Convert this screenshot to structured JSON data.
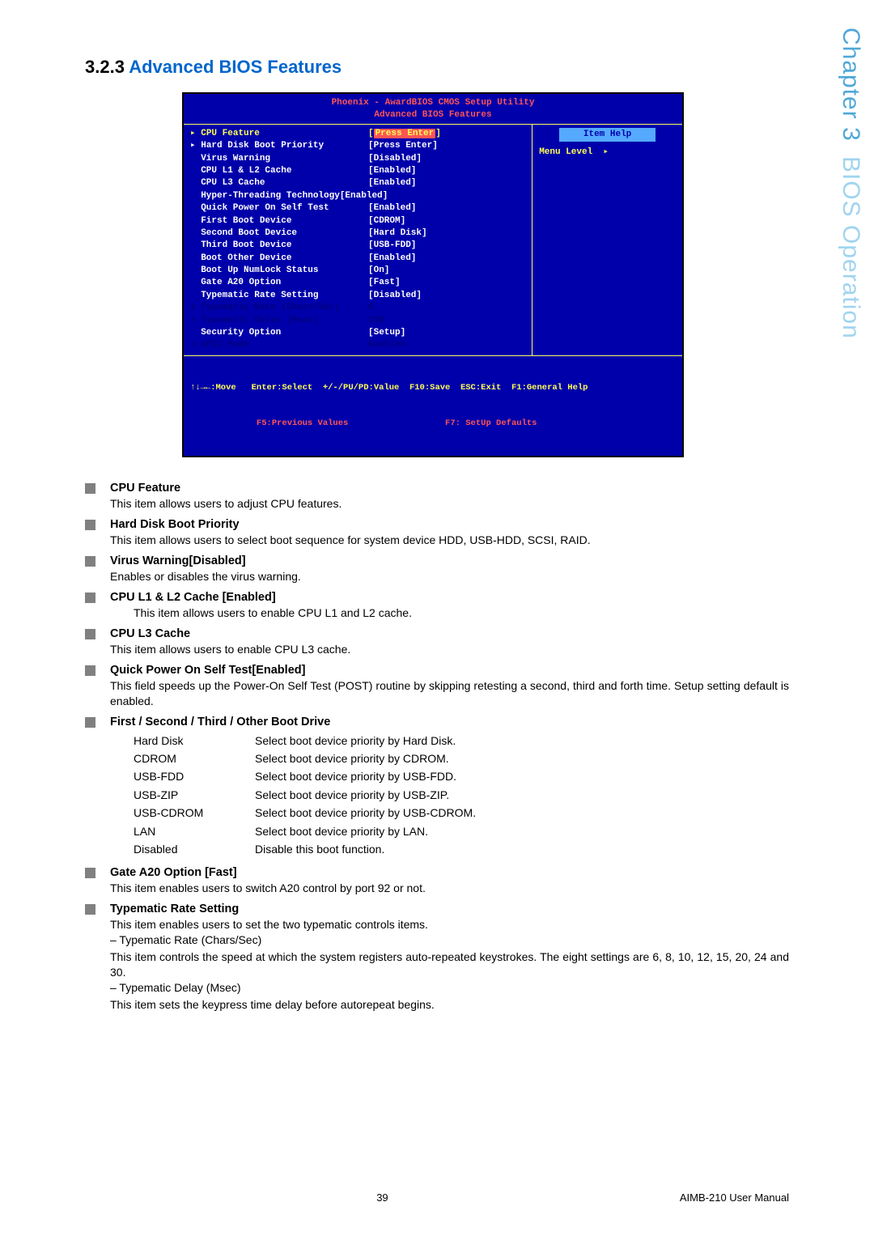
{
  "section": {
    "number": "3.2.3",
    "title": "Advanced BIOS Features"
  },
  "side_tab": {
    "chapter": "Chapter 3",
    "name": "BIOS Operation"
  },
  "bios": {
    "header_l1": "Phoenix - AwardBIOS CMOS Setup Utility",
    "header_l2": "Advanced BIOS Features",
    "right": {
      "item_help": "Item Help",
      "menu_level_label": "Menu Level",
      "menu_level_arrow": "▸"
    },
    "rows": [
      {
        "prefix": "▸",
        "label": "CPU Feature",
        "value": "[",
        "hl": "Press Enter",
        "suffix": "]",
        "row_color": "yellow"
      },
      {
        "prefix": "▸",
        "label": "Hard Disk Boot Priority",
        "value": "[Press Enter]",
        "row_color": "white"
      },
      {
        "prefix": " ",
        "label": "Virus Warning",
        "value": "[Disabled]",
        "row_color": "white"
      },
      {
        "prefix": " ",
        "label": "CPU L1 & L2 Cache",
        "value": "[Enabled]",
        "row_color": "white"
      },
      {
        "prefix": " ",
        "label": "CPU L3 Cache",
        "value": "[Enabled]",
        "row_color": "white"
      },
      {
        "prefix": " ",
        "label": "Hyper-Threading Technology[Enabled]",
        "value": "",
        "row_color": "white"
      },
      {
        "prefix": " ",
        "label": "Quick Power On Self Test",
        "value": "[Enabled]",
        "row_color": "white"
      },
      {
        "prefix": " ",
        "label": "First Boot Device",
        "value": "[CDROM]",
        "row_color": "white"
      },
      {
        "prefix": " ",
        "label": "Second Boot Device",
        "value": "[Hard Disk]",
        "row_color": "white"
      },
      {
        "prefix": " ",
        "label": "Third Boot Device",
        "value": "[USB-FDD]",
        "row_color": "white"
      },
      {
        "prefix": " ",
        "label": "Boot Other Device",
        "value": "[Enabled]",
        "row_color": "white"
      },
      {
        "prefix": " ",
        "label": "Boot Up NumLock Status",
        "value": "[On]",
        "row_color": "white"
      },
      {
        "prefix": " ",
        "label": "Gate A20 Option",
        "value": "[Fast]",
        "row_color": "white"
      },
      {
        "prefix": " ",
        "label": "Typematic Rate Setting",
        "value": "[Disabled]",
        "row_color": "white"
      },
      {
        "prefix": "x",
        "label": "Typematic Rate (Chars/Sec)",
        "value": "6",
        "row_color": "darkblue"
      },
      {
        "prefix": "x",
        "label": "Typematic Delay (Msec)",
        "value": "250",
        "row_color": "darkblue"
      },
      {
        "prefix": " ",
        "label": "Security Option",
        "value": "[Setup]",
        "row_color": "white"
      },
      {
        "prefix": "x",
        "label": "APIC Mode",
        "value": "Enabled",
        "row_color": "darkblue"
      }
    ],
    "footer_l1": "↑↓→←:Move   Enter:Select  +/-/PU/PD:Value  F10:Save  ESC:Exit  F1:General Help",
    "footer_l2": "             F5:Previous Values                   F7: SetUp Defaults"
  },
  "features": [
    {
      "title": "CPU Feature",
      "desc": "This item allows users to adjust CPU features."
    },
    {
      "title": "Hard Disk Boot Priority",
      "desc": "This item allows users to select boot sequence for system device HDD, USB-HDD, SCSI, RAID."
    },
    {
      "title": "Virus Warning[Disabled]",
      "desc": "Enables or disables the virus warning."
    },
    {
      "title": "CPU L1 & L2 Cache [Enabled]",
      "desc_indent": "This item allows users to enable CPU L1 and L2 cache."
    },
    {
      "title": "CPU L3 Cache",
      "desc": "This item allows users to enable CPU L3 cache."
    },
    {
      "title": "Quick Power On Self Test[Enabled]",
      "desc": "This field speeds up the Power-On Self Test (POST) routine by skipping retesting a second, third and forth time. Setup setting default is enabled."
    },
    {
      "title": "First / Second / Third / Other Boot Drive"
    }
  ],
  "boot_table": [
    {
      "name": "Hard Disk",
      "desc": "Select boot device priority by Hard Disk."
    },
    {
      "name": "CDROM",
      "desc": "Select boot device priority by CDROM."
    },
    {
      "name": "USB-FDD",
      "desc": "Select boot device priority by USB-FDD."
    },
    {
      "name": "USB-ZIP",
      "desc": "Select boot device priority by USB-ZIP."
    },
    {
      "name": "USB-CDROM",
      "desc": "Select boot device priority by USB-CDROM."
    },
    {
      "name": "LAN",
      "desc": "Select boot device priority by LAN."
    },
    {
      "name": "Disabled",
      "desc": "Disable this boot function."
    }
  ],
  "features2": [
    {
      "title": "Gate A20 Option [Fast]",
      "desc": "This item enables users to switch A20 control by port 92 or not."
    },
    {
      "title": "Typematic Rate Setting",
      "desc": "This item enables users to set the two typematic controls items.",
      "sub1_dash": "– Typematic Rate (Chars/Sec)",
      "sub1_desc": "This item controls the speed at which the system registers auto-repeated keystrokes. The eight settings are 6, 8, 10, 12, 15, 20, 24 and 30.",
      "sub2_dash": "– Typematic Delay (Msec)",
      "sub2_desc": "This item sets the keypress time delay before autorepeat begins."
    }
  ],
  "footer": {
    "page": "39",
    "manual": "AIMB-210 User Manual"
  }
}
